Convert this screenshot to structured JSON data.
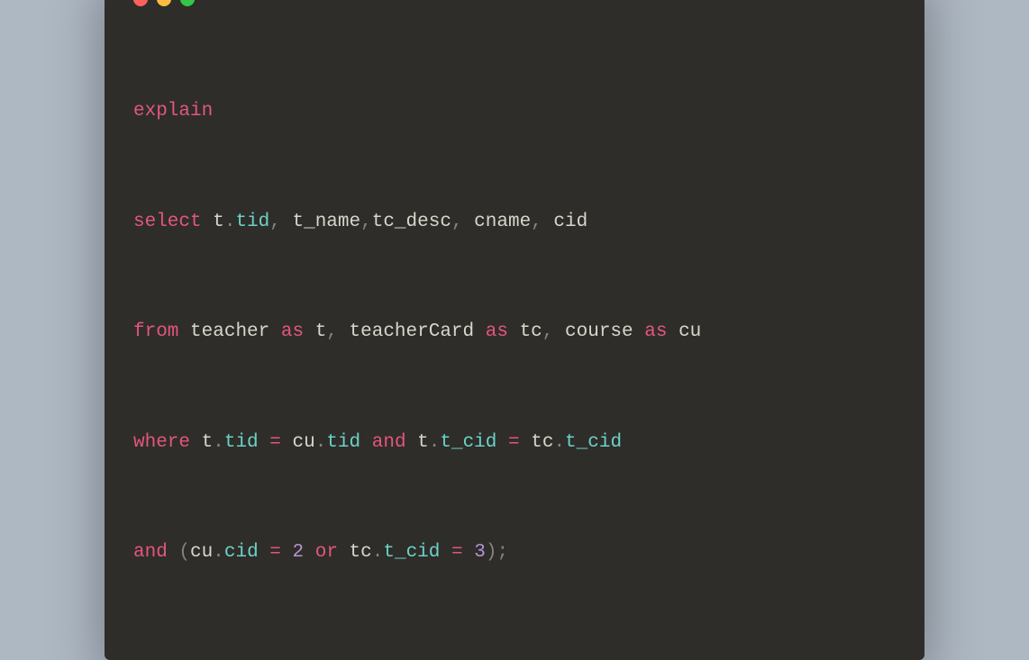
{
  "code": {
    "line1": {
      "explain": "explain"
    },
    "line2": {
      "select": "select",
      "t": "t",
      "dot1": ".",
      "tid": "tid",
      "comma1": ",",
      "sp1": " ",
      "t_name": "t_name",
      "comma2": ",",
      "tc_desc": "tc_desc",
      "comma3": ",",
      "sp2": " ",
      "cname": "cname",
      "comma4": ",",
      "sp3": " ",
      "cid": "cid"
    },
    "line3": {
      "from": "from",
      "teacher": "teacher",
      "as1": "as",
      "t": "t",
      "comma1": ",",
      "teacherCard": "teacherCard",
      "as2": "as",
      "tc": "tc",
      "comma2": ",",
      "course": "course",
      "as3": "as",
      "cu": "cu"
    },
    "line4": {
      "where": "where",
      "t1": "t",
      "dot1": ".",
      "tid1": "tid",
      "eq1": "=",
      "cu": "cu",
      "dot2": ".",
      "tid2": "tid",
      "and1": "and",
      "t2": "t",
      "dot3": ".",
      "t_cid1": "t_cid",
      "eq2": "=",
      "tc": "tc",
      "dot4": ".",
      "t_cid2": "t_cid"
    },
    "line5": {
      "and": "and",
      "lparen": "(",
      "cu": "cu",
      "dot1": ".",
      "cid": "cid",
      "eq1": "=",
      "num1": "2",
      "or": "or",
      "tc": "tc",
      "dot2": ".",
      "t_cid": "t_cid",
      "eq2": "=",
      "num2": "3",
      "rparen": ")",
      "semi": ";"
    }
  }
}
